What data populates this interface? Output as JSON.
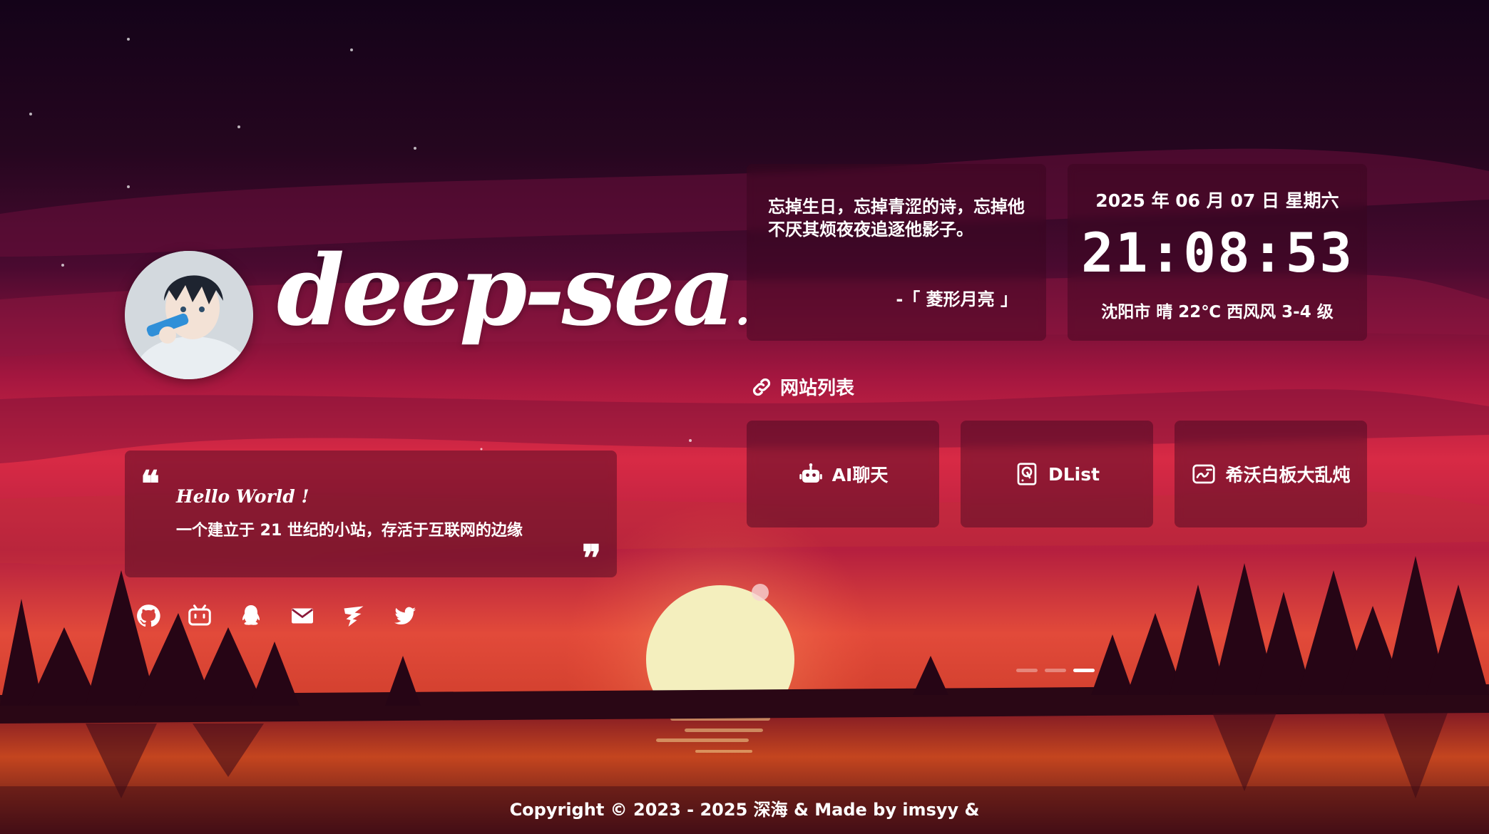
{
  "site": {
    "logo_text": "deep-sea",
    "logo_dot": "."
  },
  "intro": {
    "quote_open": "❝",
    "quote_close": "❞",
    "hello": "Hello World !",
    "text": "一个建立于 21 世纪的小站，存活于互联网的边缘"
  },
  "social": [
    {
      "icon": "github-icon"
    },
    {
      "icon": "bilibili-icon"
    },
    {
      "icon": "qq-icon"
    },
    {
      "icon": "email-icon"
    },
    {
      "icon": "feather-icon"
    },
    {
      "icon": "twitter-icon"
    }
  ],
  "hitokoto": {
    "text": "忘掉生日，忘掉青涩的诗，忘掉他不厌其烦夜夜追逐他影子。",
    "from": "-「 菱形月亮 」"
  },
  "time_card": {
    "date": "2025 年 06 月 07 日 星期六",
    "time": "21:08:53",
    "weather": "沈阳市 晴 22℃ 西风风 3-4 级"
  },
  "site_list": {
    "title": "网站列表",
    "icon": "link-icon",
    "items": [
      {
        "label": "AI聊天",
        "icon": "robot-icon"
      },
      {
        "label": "DList",
        "icon": "drive-icon"
      },
      {
        "label": "希沃白板大乱炖",
        "icon": "whiteboard-icon"
      }
    ]
  },
  "pager": {
    "count": 3,
    "active_index": 2
  },
  "footer": {
    "text": "Copyright  © 2023 - 2025 深海 & Made by imsyy &"
  },
  "colors": {
    "card_bg": "#37051c",
    "accent_sun": "#f6f0c0"
  }
}
